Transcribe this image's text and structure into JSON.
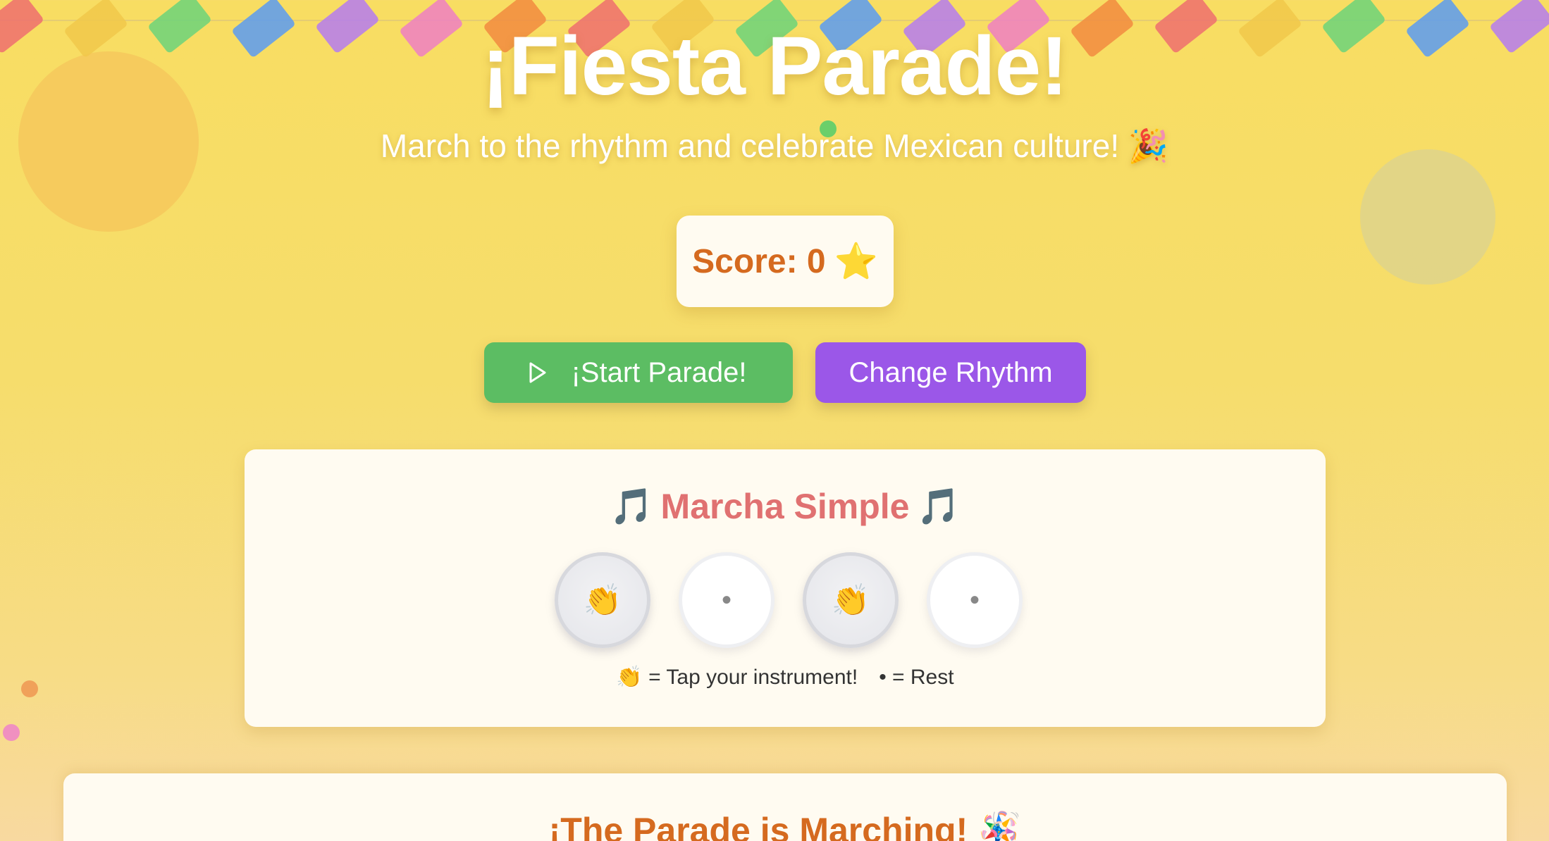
{
  "header": {
    "title": "¡Fiesta Parade!",
    "subtitle": "March to the rhythm and celebrate Mexican culture! 🎉"
  },
  "score": {
    "label": "Score: 0",
    "star_icon": "⭐"
  },
  "buttons": {
    "start_label": "¡Start Parade!",
    "change_rhythm_label": "Change Rhythm"
  },
  "rhythm": {
    "note_left": "🎵",
    "name": "Marcha Simple",
    "note_right": "🎵",
    "beats": [
      "👏",
      "•",
      "👏",
      "•"
    ],
    "legend_tap": "👏 = Tap your instrument!",
    "legend_rest": "• = Rest"
  },
  "parade": {
    "title": "¡The Parade is Marching! 🪅"
  },
  "colors": {
    "start_button": "#5cbd63",
    "change_rhythm_button": "#9b57e8",
    "score_text": "#d56a1f",
    "rhythm_title": "#e07171",
    "flags": [
      "#ef6f6f",
      "#f1c84a",
      "#6cd47a",
      "#5b9bf2",
      "#b57bf0",
      "#ef7fc3",
      "#f28b3f"
    ]
  }
}
